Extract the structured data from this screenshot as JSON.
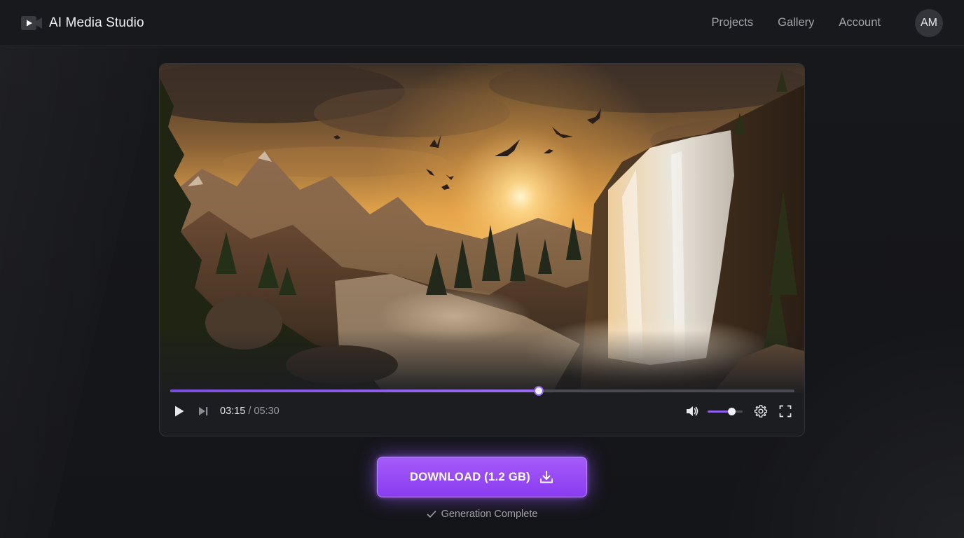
{
  "header": {
    "title": "AI Media Studio",
    "nav": [
      "Projects",
      "Gallery",
      "Account"
    ],
    "avatar_initials": "AM"
  },
  "player": {
    "current_time": "03:15",
    "separator": "/",
    "duration": "05:30",
    "progress_fraction": 0.5909,
    "volume_fraction": 0.68,
    "accent_color": "#8f62ee"
  },
  "download": {
    "label": "DOWNLOAD (1.2 GB)",
    "icon": "download-icon"
  },
  "status": {
    "text": "Generation Complete",
    "icon": "check-icon"
  },
  "icons": {
    "brand": "video-camera-icon",
    "play": "play-icon",
    "next": "skip-next-icon",
    "volume": "volume-icon",
    "settings": "gear-icon",
    "fullscreen": "fullscreen-icon"
  }
}
